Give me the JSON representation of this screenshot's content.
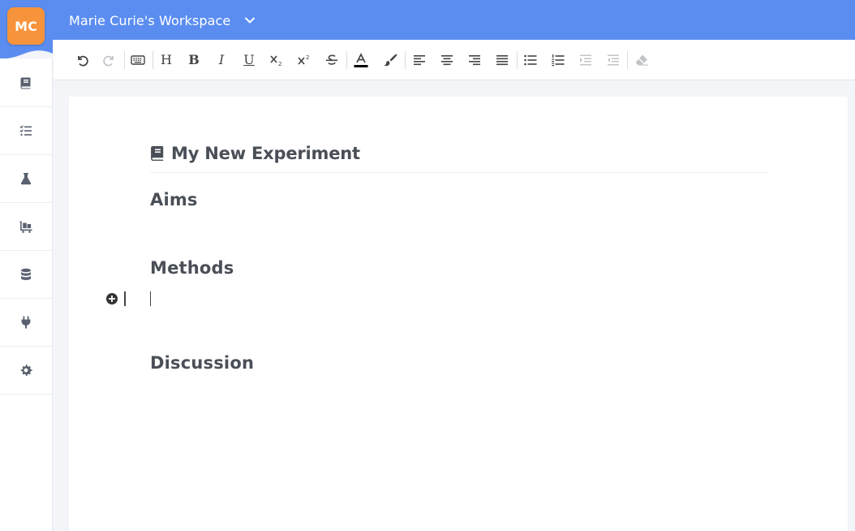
{
  "header": {
    "avatar_initials": "MC",
    "workspace_name": "Marie Curie's Workspace",
    "accent_color": "#5b8df0",
    "avatar_color": "#f7933a"
  },
  "sidebar": {
    "items": [
      {
        "icon": "notebook-icon"
      },
      {
        "icon": "checklist-icon"
      },
      {
        "icon": "flask-icon"
      },
      {
        "icon": "dolly-icon"
      },
      {
        "icon": "database-icon"
      },
      {
        "icon": "plug-icon"
      },
      {
        "icon": "gear-icon"
      }
    ]
  },
  "toolbar": {
    "heading_label": "H",
    "bold_label": "B",
    "italic_label": "I",
    "underline_label": "U",
    "disabled": [
      "redo",
      "indent",
      "outdent",
      "clear-format"
    ]
  },
  "document": {
    "title": "My New Experiment",
    "sections": [
      "Aims",
      "Methods",
      "Discussion"
    ]
  }
}
